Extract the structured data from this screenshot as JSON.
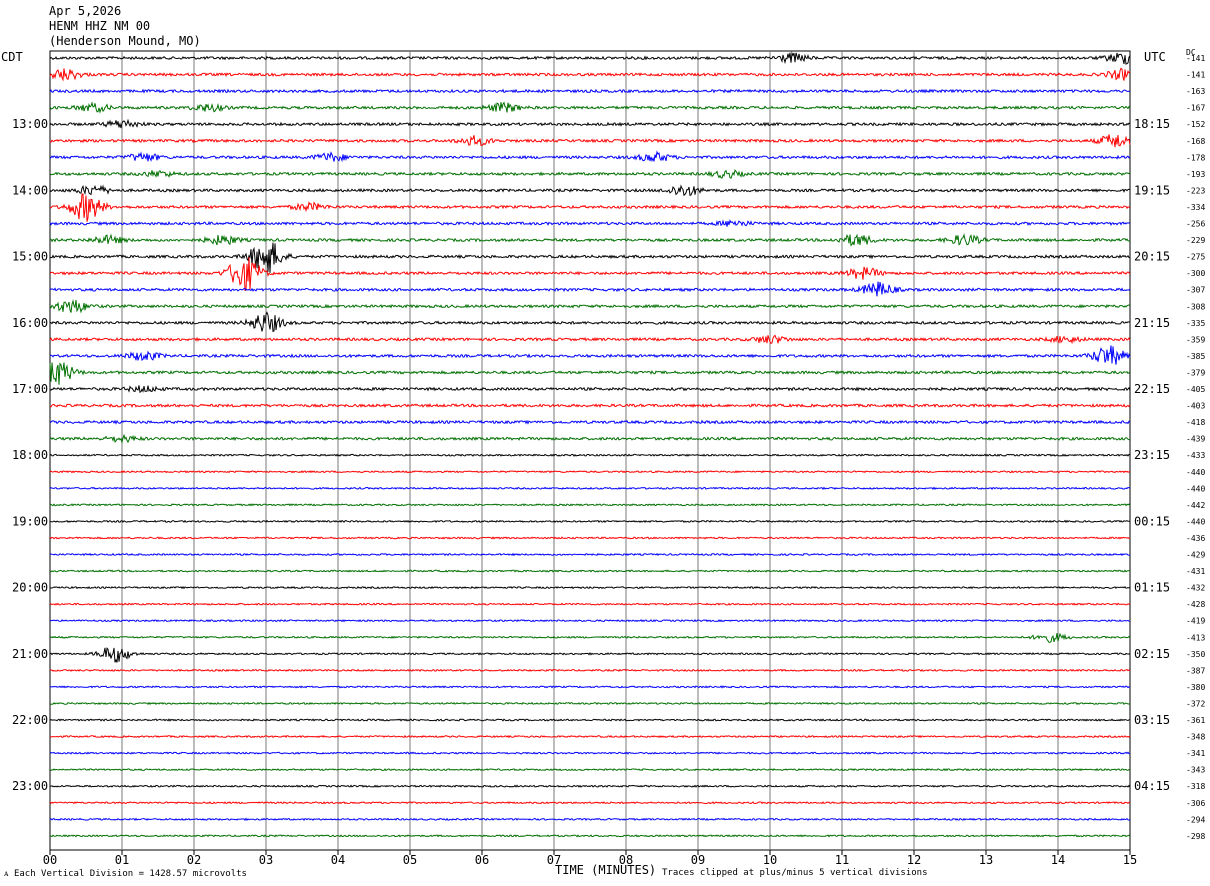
{
  "header": {
    "date": "Apr 5,2026",
    "station": "HENM HHZ NM 00",
    "location": "(Henderson Mound, MO)"
  },
  "left_tz": "CDT",
  "right_tz": "UTC",
  "dc_label": "DC",
  "footer": {
    "scale": "Each Vertical Division = 1428.57 microvolts",
    "xlabel": "TIME (MINUTES)",
    "clip": "Traces clipped at plus/minus 5 vertical divisions"
  },
  "chart_data": {
    "type": "line",
    "title": "HENM HHZ NM 00",
    "xlabel": "TIME (MINUTES)",
    "x_range": [
      0,
      15
    ],
    "x_ticks": [
      "00",
      "01",
      "02",
      "03",
      "04",
      "05",
      "06",
      "07",
      "08",
      "09",
      "10",
      "11",
      "12",
      "13",
      "14",
      "15"
    ],
    "row_minutes": 15,
    "trace_colors": [
      "#000000",
      "#ff0000",
      "#0000ff",
      "#007000"
    ],
    "grid_color": "#7a7a7a",
    "left_hour_labels": [
      "13:00",
      "14:00",
      "15:00",
      "16:00",
      "17:00",
      "18:00",
      "19:00",
      "20:00",
      "21:00",
      "22:00",
      "23:00"
    ],
    "right_hour_labels": [
      "18:15",
      "19:15",
      "20:15",
      "21:15",
      "22:15",
      "23:15",
      "00:15",
      "01:15",
      "02:15",
      "03:15",
      "04:15"
    ],
    "dc_offsets": [
      "141",
      "141",
      "163",
      "167",
      "152",
      "168",
      "178",
      "193",
      "223",
      "334",
      "256",
      "229",
      "275",
      "300",
      "307",
      "308",
      "335",
      "359",
      "385",
      "379",
      "405",
      "403",
      "418",
      "439",
      "433",
      "440",
      "440",
      "442",
      "440",
      "436",
      "429",
      "431",
      "432",
      "428",
      "419",
      "413",
      "350",
      "387",
      "380",
      "372",
      "361",
      "348",
      "341",
      "343",
      "318",
      "306",
      "294",
      "298"
    ],
    "activity": [
      [
        [
          10.3,
          0.8
        ],
        [
          14.9,
          1.0
        ]
      ],
      [
        [
          0.2,
          1.0
        ],
        [
          14.9,
          0.9
        ]
      ],
      [],
      [
        [
          0.6,
          0.7
        ],
        [
          2.2,
          0.6
        ],
        [
          6.3,
          0.8
        ]
      ],
      [
        [
          1.0,
          0.7
        ]
      ],
      [
        [
          5.9,
          0.8
        ],
        [
          14.8,
          1.2
        ]
      ],
      [
        [
          1.3,
          0.7
        ],
        [
          3.9,
          0.7
        ],
        [
          8.4,
          0.8
        ]
      ],
      [
        [
          1.5,
          0.5
        ],
        [
          9.4,
          0.6
        ]
      ],
      [
        [
          0.6,
          0.8
        ],
        [
          8.8,
          1.0
        ]
      ],
      [
        [
          0.5,
          2.5
        ],
        [
          3.6,
          0.6
        ]
      ],
      [
        [
          9.5,
          0.5
        ]
      ],
      [
        [
          0.8,
          0.7
        ],
        [
          2.4,
          0.8
        ],
        [
          11.2,
          1.0
        ],
        [
          12.7,
          0.9
        ]
      ],
      [
        [
          3.0,
          3.2
        ]
      ],
      [
        [
          2.7,
          3.2
        ],
        [
          11.3,
          1.0
        ]
      ],
      [
        [
          11.5,
          1.3
        ]
      ],
      [
        [
          0.3,
          1.2
        ]
      ],
      [
        [
          3.0,
          1.8
        ]
      ],
      [
        [
          10.0,
          0.7
        ],
        [
          14.1,
          0.5
        ]
      ],
      [
        [
          1.3,
          0.8
        ],
        [
          14.7,
          1.8
        ]
      ],
      [
        [
          0.1,
          2.2
        ]
      ],
      [
        [
          1.3,
          0.5
        ]
      ],
      [],
      [],
      [
        [
          1.0,
          0.5
        ]
      ],
      [],
      [],
      [],
      [],
      [],
      [],
      [],
      [],
      [],
      [],
      [],
      [
        [
          13.9,
          0.8
        ]
      ],
      [
        [
          0.9,
          1.5
        ]
      ],
      [],
      [],
      [],
      [],
      [],
      [],
      [],
      [],
      [],
      [],
      []
    ]
  }
}
